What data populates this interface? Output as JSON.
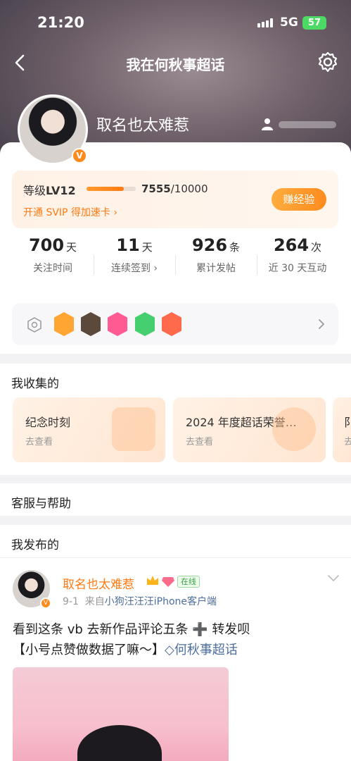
{
  "status_bar": {
    "time": "21:20",
    "network": "5G",
    "battery": "57"
  },
  "nav": {
    "title": "我在何秋事超话"
  },
  "profile": {
    "username": "取名也太难惹",
    "badge": "V"
  },
  "level": {
    "label_prefix": "等级",
    "level": "LV12",
    "progress_current": "7555",
    "progress_total": "/10000",
    "progress_fraction": 0.7555,
    "svip_link": "开通 SVIP 得加速卡 ›",
    "earn_button": "赚经验"
  },
  "stats": [
    {
      "value": "700",
      "unit": "天",
      "label": "关注时间"
    },
    {
      "value": "11",
      "unit": "天",
      "label": "连续签到 ›"
    },
    {
      "value": "926",
      "unit": "条",
      "label": "累计发帖"
    },
    {
      "value": "264",
      "unit": "次",
      "label": "近 30 天互动"
    }
  ],
  "badges": {
    "colors": [
      "#ffa533",
      "#5b4a3b",
      "#ff5a92",
      "#46cf6f",
      "#ff6a4d"
    ]
  },
  "collection": {
    "title": "我收集的",
    "cards": [
      {
        "title": "纪念时刻",
        "sub": "去查看"
      },
      {
        "title": "2024 年度超话荣誉…",
        "sub": "去查看"
      },
      {
        "title": "阝",
        "sub": "去"
      }
    ]
  },
  "help": {
    "title": "客服与帮助"
  },
  "posts": {
    "title": "我发布的",
    "item": {
      "author": "取名也太难惹",
      "online": "在线",
      "date": "9-1",
      "from_prefix": "来自",
      "source": "小狗汪汪汪iPhone客户端",
      "text_line1": "看到这条 vb 去新作品评论五条 ➕ 转发呗",
      "text_line2_prefix": "【小号点赞做数据了嘛～】",
      "topic": "何秋事超话"
    }
  },
  "colors": {
    "accent": "#ff7a12",
    "link": "#4d6e9a",
    "online_green": "#3aa03d"
  }
}
